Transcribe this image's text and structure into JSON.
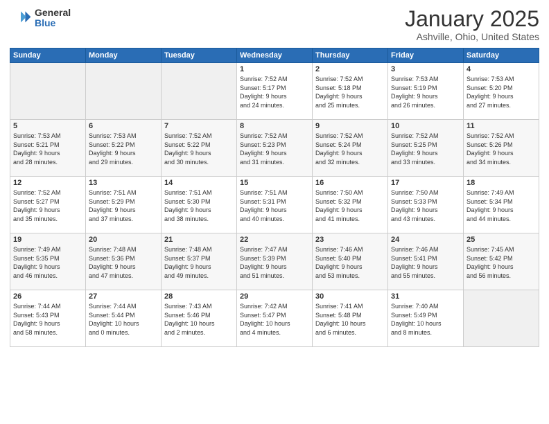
{
  "header": {
    "logo_general": "General",
    "logo_blue": "Blue",
    "month_title": "January 2025",
    "subtitle": "Ashville, Ohio, United States"
  },
  "days_of_week": [
    "Sunday",
    "Monday",
    "Tuesday",
    "Wednesday",
    "Thursday",
    "Friday",
    "Saturday"
  ],
  "weeks": [
    [
      {
        "day": "",
        "info": ""
      },
      {
        "day": "",
        "info": ""
      },
      {
        "day": "",
        "info": ""
      },
      {
        "day": "1",
        "info": "Sunrise: 7:52 AM\nSunset: 5:17 PM\nDaylight: 9 hours\nand 24 minutes."
      },
      {
        "day": "2",
        "info": "Sunrise: 7:52 AM\nSunset: 5:18 PM\nDaylight: 9 hours\nand 25 minutes."
      },
      {
        "day": "3",
        "info": "Sunrise: 7:53 AM\nSunset: 5:19 PM\nDaylight: 9 hours\nand 26 minutes."
      },
      {
        "day": "4",
        "info": "Sunrise: 7:53 AM\nSunset: 5:20 PM\nDaylight: 9 hours\nand 27 minutes."
      }
    ],
    [
      {
        "day": "5",
        "info": "Sunrise: 7:53 AM\nSunset: 5:21 PM\nDaylight: 9 hours\nand 28 minutes."
      },
      {
        "day": "6",
        "info": "Sunrise: 7:53 AM\nSunset: 5:22 PM\nDaylight: 9 hours\nand 29 minutes."
      },
      {
        "day": "7",
        "info": "Sunrise: 7:52 AM\nSunset: 5:22 PM\nDaylight: 9 hours\nand 30 minutes."
      },
      {
        "day": "8",
        "info": "Sunrise: 7:52 AM\nSunset: 5:23 PM\nDaylight: 9 hours\nand 31 minutes."
      },
      {
        "day": "9",
        "info": "Sunrise: 7:52 AM\nSunset: 5:24 PM\nDaylight: 9 hours\nand 32 minutes."
      },
      {
        "day": "10",
        "info": "Sunrise: 7:52 AM\nSunset: 5:25 PM\nDaylight: 9 hours\nand 33 minutes."
      },
      {
        "day": "11",
        "info": "Sunrise: 7:52 AM\nSunset: 5:26 PM\nDaylight: 9 hours\nand 34 minutes."
      }
    ],
    [
      {
        "day": "12",
        "info": "Sunrise: 7:52 AM\nSunset: 5:27 PM\nDaylight: 9 hours\nand 35 minutes."
      },
      {
        "day": "13",
        "info": "Sunrise: 7:51 AM\nSunset: 5:29 PM\nDaylight: 9 hours\nand 37 minutes."
      },
      {
        "day": "14",
        "info": "Sunrise: 7:51 AM\nSunset: 5:30 PM\nDaylight: 9 hours\nand 38 minutes."
      },
      {
        "day": "15",
        "info": "Sunrise: 7:51 AM\nSunset: 5:31 PM\nDaylight: 9 hours\nand 40 minutes."
      },
      {
        "day": "16",
        "info": "Sunrise: 7:50 AM\nSunset: 5:32 PM\nDaylight: 9 hours\nand 41 minutes."
      },
      {
        "day": "17",
        "info": "Sunrise: 7:50 AM\nSunset: 5:33 PM\nDaylight: 9 hours\nand 43 minutes."
      },
      {
        "day": "18",
        "info": "Sunrise: 7:49 AM\nSunset: 5:34 PM\nDaylight: 9 hours\nand 44 minutes."
      }
    ],
    [
      {
        "day": "19",
        "info": "Sunrise: 7:49 AM\nSunset: 5:35 PM\nDaylight: 9 hours\nand 46 minutes."
      },
      {
        "day": "20",
        "info": "Sunrise: 7:48 AM\nSunset: 5:36 PM\nDaylight: 9 hours\nand 47 minutes."
      },
      {
        "day": "21",
        "info": "Sunrise: 7:48 AM\nSunset: 5:37 PM\nDaylight: 9 hours\nand 49 minutes."
      },
      {
        "day": "22",
        "info": "Sunrise: 7:47 AM\nSunset: 5:39 PM\nDaylight: 9 hours\nand 51 minutes."
      },
      {
        "day": "23",
        "info": "Sunrise: 7:46 AM\nSunset: 5:40 PM\nDaylight: 9 hours\nand 53 minutes."
      },
      {
        "day": "24",
        "info": "Sunrise: 7:46 AM\nSunset: 5:41 PM\nDaylight: 9 hours\nand 55 minutes."
      },
      {
        "day": "25",
        "info": "Sunrise: 7:45 AM\nSunset: 5:42 PM\nDaylight: 9 hours\nand 56 minutes."
      }
    ],
    [
      {
        "day": "26",
        "info": "Sunrise: 7:44 AM\nSunset: 5:43 PM\nDaylight: 9 hours\nand 58 minutes."
      },
      {
        "day": "27",
        "info": "Sunrise: 7:44 AM\nSunset: 5:44 PM\nDaylight: 10 hours\nand 0 minutes."
      },
      {
        "day": "28",
        "info": "Sunrise: 7:43 AM\nSunset: 5:46 PM\nDaylight: 10 hours\nand 2 minutes."
      },
      {
        "day": "29",
        "info": "Sunrise: 7:42 AM\nSunset: 5:47 PM\nDaylight: 10 hours\nand 4 minutes."
      },
      {
        "day": "30",
        "info": "Sunrise: 7:41 AM\nSunset: 5:48 PM\nDaylight: 10 hours\nand 6 minutes."
      },
      {
        "day": "31",
        "info": "Sunrise: 7:40 AM\nSunset: 5:49 PM\nDaylight: 10 hours\nand 8 minutes."
      },
      {
        "day": "",
        "info": ""
      }
    ]
  ]
}
